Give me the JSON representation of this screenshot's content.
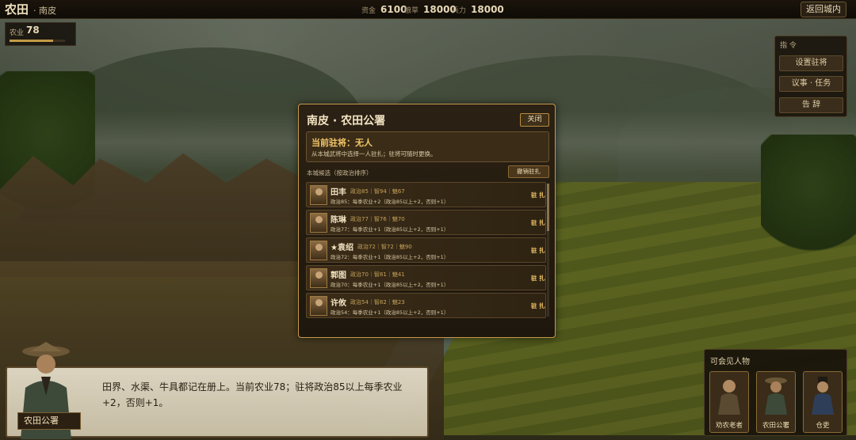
{
  "topbar": {
    "city": "农田",
    "sub": "· 南皮",
    "resources": [
      {
        "label": "资金",
        "value": "6100"
      },
      {
        "label": "粮草",
        "value": "18000"
      },
      {
        "label": "兵力",
        "value": "18000"
      }
    ],
    "back_label": "返回城内"
  },
  "agriculture": {
    "label": "农业",
    "value": "78",
    "level": 78
  },
  "commands": {
    "title": "指 令",
    "buttons": [
      "设置驻将",
      "议事 · 任务",
      "告 辞"
    ]
  },
  "modal": {
    "title": "南皮 · 农田公署",
    "close_label": "关闭",
    "garrison_status": "当前驻将：无人",
    "garrison_hint": "从本城武将中选择一人驻扎；驻将可随时更换。",
    "candidates_title": "本城候选（按政治排序）",
    "revoke_label": "撤销驻扎",
    "candidates": [
      {
        "name": "田丰",
        "stats": "政治85｜智94｜魅67",
        "desc": "政治85：每季农业+2（政治85以上+2，否则+1）",
        "action": "驻 扎"
      },
      {
        "name": "陈琳",
        "stats": "政治77｜智76｜魅70",
        "desc": "政治77：每季农业+1（政治85以上+2，否则+1）",
        "action": "驻 扎"
      },
      {
        "name": "★袁绍",
        "stats": "政治72｜智72｜魅90",
        "desc": "政治72：每季农业+1（政治85以上+2，否则+1）",
        "action": "驻 扎"
      },
      {
        "name": "郭图",
        "stats": "政治70｜智81｜魅41",
        "desc": "政治70：每季农业+1（政治85以上+2，否则+1）",
        "action": "驻 扎"
      },
      {
        "name": "许攸",
        "stats": "政治54｜智82｜魅23",
        "desc": "政治54：每季农业+1（政治85以上+2，否则+1）",
        "action": "驻 扎"
      }
    ]
  },
  "dialogue": {
    "text": "田界、水渠、牛具都记在册上。当前农业78；驻将政治85以上每季农业+2，否则+1。",
    "speaker": "农田公署"
  },
  "people": {
    "title": "可会见人物",
    "items": [
      "劝农老者",
      "农田公署",
      "仓吏"
    ]
  },
  "colors": {
    "accent": "#c69a48",
    "highlight": "#f3c66a"
  }
}
